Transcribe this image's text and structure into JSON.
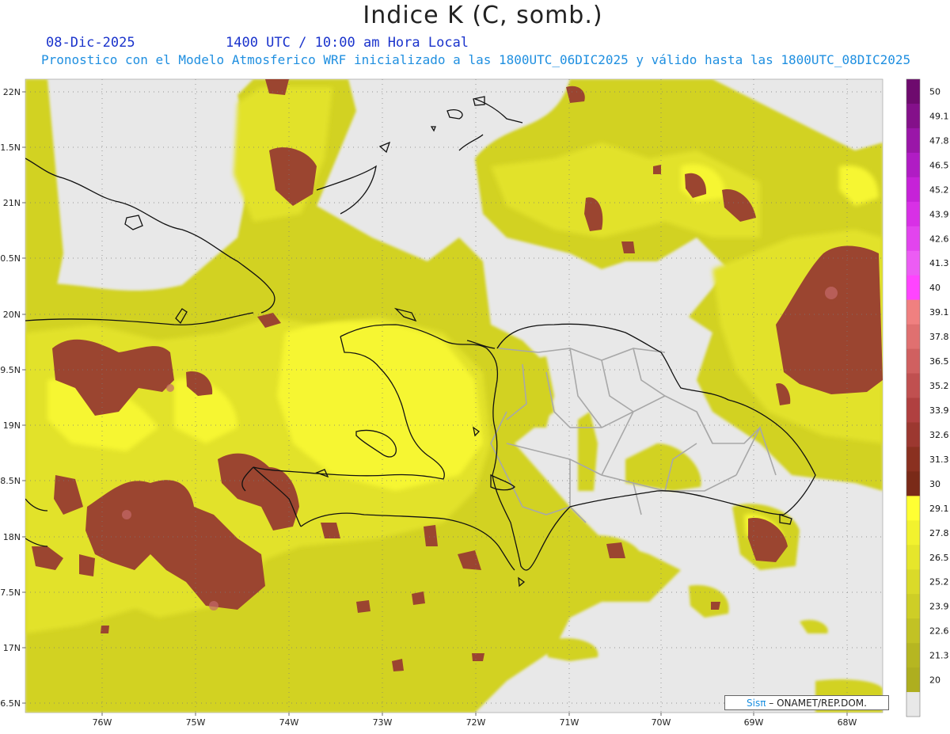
{
  "title": "Indice K (C, somb.)",
  "date": "08-Dic-2025",
  "time": "1400 UTC / 10:00 am Hora Local",
  "description": "Pronostico con el Modelo Atmosferico WRF inicializado a las 1800UTC_06DIC2025 y válido hasta las  1800UTC_08DIC2025",
  "credit": {
    "brand": "Sisπ",
    "separator": " – ",
    "org": "ONAMET/REP.DOM."
  },
  "lat_labels": [
    "22N",
    "1.5N",
    "21N",
    "0.5N",
    "20N",
    "9.5N",
    "19N",
    "8.5N",
    "18N",
    "7.5N",
    "17N",
    "6.5N"
  ],
  "lon_labels": [
    "76W",
    "75W",
    "74W",
    "73W",
    "72W",
    "71W",
    "70W",
    "69W",
    "68W"
  ],
  "colorbar": {
    "labels": [
      "50",
      "49.1",
      "47.8",
      "46.5",
      "45.2",
      "43.9",
      "42.6",
      "41.3",
      "40",
      "39.1",
      "37.8",
      "36.5",
      "35.2",
      "33.9",
      "32.6",
      "31.3",
      "30",
      "29.1",
      "27.8",
      "26.5",
      "25.2",
      "23.9",
      "22.6",
      "21.3",
      "20"
    ],
    "colors": [
      "#6e0a6e",
      "#84108a",
      "#9a16a8",
      "#b01cc4",
      "#c622d8",
      "#d830e6",
      "#e244ee",
      "#ec5cf4",
      "#ff44ff",
      "#f08080",
      "#e07070",
      "#d06060",
      "#c05050",
      "#b04040",
      "#9c3830",
      "#8a3020",
      "#7a2a18",
      "#ffff33",
      "#f2f22e",
      "#e6e62b",
      "#dada29",
      "#cece26",
      "#c2c224",
      "#b6b621",
      "#aeae1f"
    ],
    "no_data_color": "#e8e8e8"
  },
  "map": {
    "no_data_color": "#e8e8e8",
    "k_colors": {
      "low": "#c8c820",
      "mid": "#dede2a",
      "high": "#f4f432",
      "storm": "#9b4530",
      "storm_light": "#c06060"
    }
  }
}
